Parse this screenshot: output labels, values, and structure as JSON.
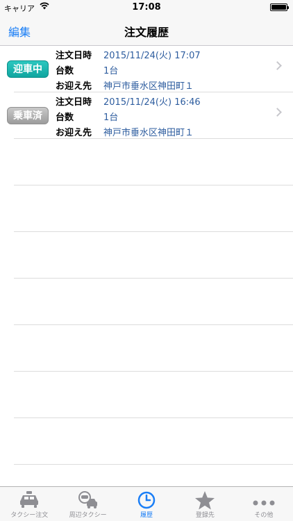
{
  "status_bar": {
    "carrier": "キャリア",
    "time": "17:08"
  },
  "nav": {
    "edit_label": "編集",
    "title": "注文履歴"
  },
  "orders": [
    {
      "status": "迎車中",
      "status_color": "#14b0a9",
      "fields": {
        "datetime_label": "注文日時",
        "datetime": "2015/11/24(火) 17:07",
        "count_label": "台数",
        "count": "1台",
        "pickup_label": "お迎え先",
        "pickup": "神戸市垂水区神田町１"
      }
    },
    {
      "status": "乗車済",
      "status_color": "#a8a8a8",
      "fields": {
        "datetime_label": "注文日時",
        "datetime": "2015/11/24(火) 16:46",
        "count_label": "台数",
        "count": "1台",
        "pickup_label": "お迎え先",
        "pickup": "神戸市垂水区神田町１"
      }
    }
  ],
  "tabs": [
    {
      "label": "タクシー注文",
      "icon": "taxi-icon"
    },
    {
      "label": "周辺タクシー",
      "icon": "nearby-taxi-icon"
    },
    {
      "label": "履歴",
      "icon": "clock-icon",
      "active": true
    },
    {
      "label": "登録先",
      "icon": "star-icon"
    },
    {
      "label": "その他",
      "icon": "more-icon"
    }
  ],
  "colors": {
    "accent": "#1a7ef6",
    "value_text": "#2e5d9f"
  }
}
